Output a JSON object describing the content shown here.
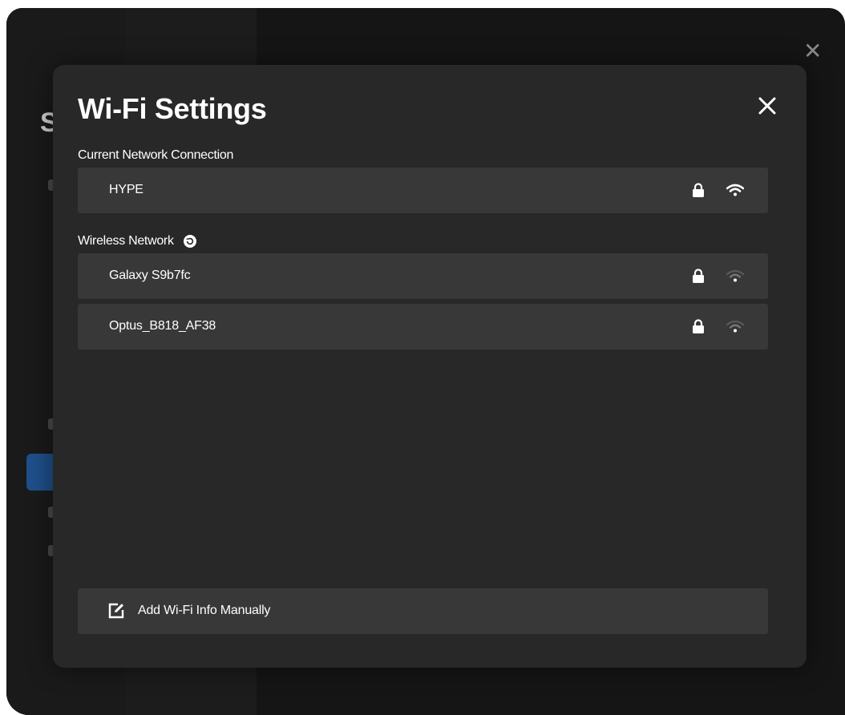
{
  "background": {
    "sidebar_title_initial": "S",
    "close_glyph": "✕"
  },
  "modal": {
    "title": "Wi-Fi Settings",
    "close_icon": "close-icon",
    "current_section_label": "Current Network Connection",
    "current_network": {
      "name": "HYPE",
      "secured": true,
      "signal": "full"
    },
    "wireless_section_label": "Wireless Network",
    "refresh_icon": "refresh-icon",
    "networks": [
      {
        "name": "Galaxy S9b7fc",
        "secured": true,
        "signal": "weak"
      },
      {
        "name": "Optus_B818_AF38",
        "secured": true,
        "signal": "weak"
      }
    ],
    "add_manual_label": "Add Wi-Fi Info Manually",
    "add_manual_icon": "edit-icon"
  },
  "colors": {
    "modal_bg": "#282828",
    "row_bg": "#383838",
    "sidebar_active": "#1f4f8a",
    "text": "#ffffff",
    "signal_dim": "#7a7a7a"
  }
}
